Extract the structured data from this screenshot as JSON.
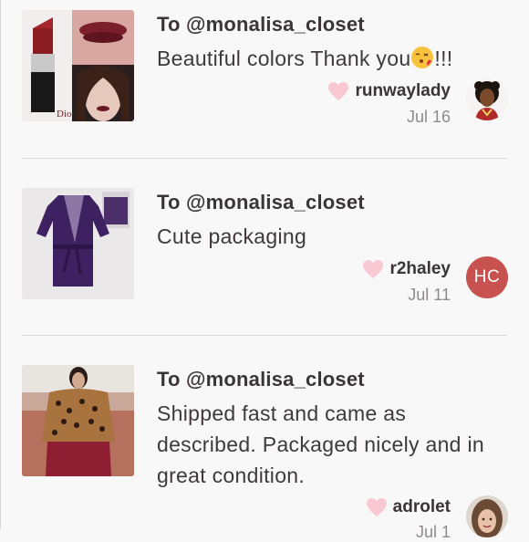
{
  "reviews": [
    {
      "to_line": "To @monalisa_closet",
      "comment_before_emoji": "Beautiful colors Thank you",
      "emoji": "kissing-face-emoji",
      "comment_after_emoji": "!!!",
      "username": "runwaylady",
      "date": "Jul 16",
      "thumb_label": "Dio",
      "avatar_icon": "bitmoji-avatar"
    },
    {
      "to_line": "To @monalisa_closet",
      "comment": "Cute packaging",
      "username": "r2haley",
      "date": "Jul 11",
      "avatar_initials": "HC"
    },
    {
      "to_line": "To @monalisa_closet",
      "comment": "Shipped fast and came as described. Packaged nicely and in great condition.",
      "username": "adrolet",
      "date": "Jul 1",
      "avatar_icon": "photo-avatar"
    }
  ],
  "colors": {
    "heart": "#f8c9d2",
    "hc_avatar": "#c8524f",
    "divider": "#dcd8da"
  }
}
